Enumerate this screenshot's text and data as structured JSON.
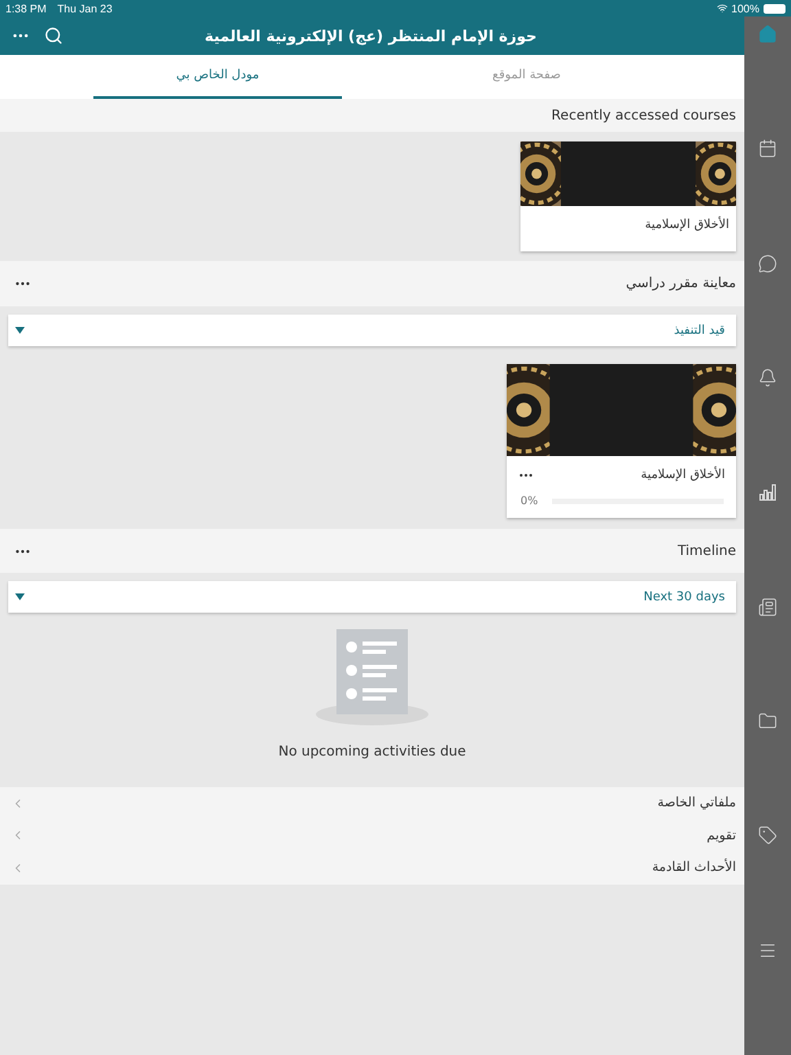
{
  "status_bar": {
    "time": "1:38 PM",
    "date": "Thu Jan 23",
    "battery": "100%"
  },
  "header": {
    "title": "حوزة الإمام المنتظر (عج) الإلكترونية العالمية"
  },
  "tabs": [
    {
      "label": "صفحة الموقع",
      "selected": false
    },
    {
      "label": "مودل الخاص بي",
      "selected": true
    }
  ],
  "recent": {
    "title": "Recently accessed courses",
    "courses": [
      {
        "name": "الأخلاق الإسلامية"
      }
    ]
  },
  "overview": {
    "title": "معاينة مقرر دراسي",
    "filter": "قيد التنفيذ",
    "courses": [
      {
        "name": "الأخلاق الإسلامية",
        "progress": "0%",
        "level": 0
      }
    ]
  },
  "timeline": {
    "title": "Timeline",
    "filter": "Next 30 days",
    "empty": "No upcoming activities due"
  },
  "links": [
    {
      "label": "ملفاتي الخاصة"
    },
    {
      "label": "تقويم"
    },
    {
      "label": "الأحداث القادمة"
    }
  ],
  "sidebar": {
    "items": [
      {
        "kind": "home",
        "selected": true
      },
      {
        "kind": "calendar",
        "selected": false
      },
      {
        "kind": "messages",
        "selected": false
      },
      {
        "kind": "notifications",
        "selected": false
      },
      {
        "kind": "grades",
        "selected": false
      },
      {
        "kind": "news",
        "selected": false
      },
      {
        "kind": "files",
        "selected": false
      },
      {
        "kind": "tags",
        "selected": false
      },
      {
        "kind": "menu",
        "selected": false
      }
    ]
  }
}
